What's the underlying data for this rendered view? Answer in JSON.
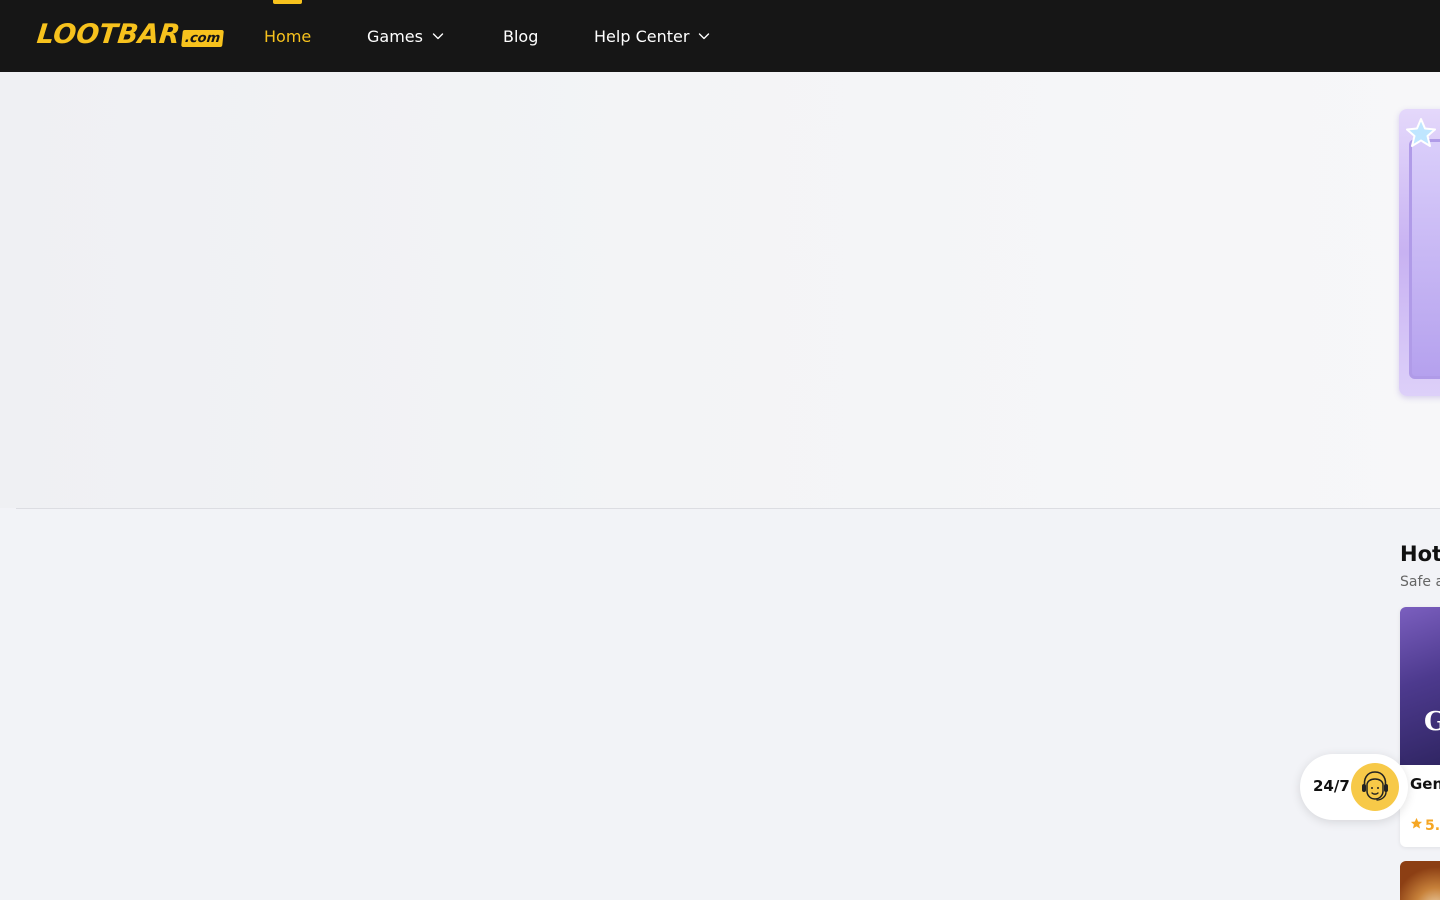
{
  "brand": {
    "logo_text": "LOOTBAR",
    "logo_suffix": ".com",
    "accent_color": "#f7c21d",
    "header_bg": "#161616"
  },
  "nav": {
    "items": [
      {
        "label": "Home",
        "active": true,
        "has_dropdown": false
      },
      {
        "label": "Games",
        "active": false,
        "has_dropdown": true
      },
      {
        "label": "Blog",
        "active": false,
        "has_dropdown": false
      },
      {
        "label": "Help Center",
        "active": false,
        "has_dropdown": true
      }
    ]
  },
  "hot_section": {
    "title": "Hot",
    "subtitle": "Safe a",
    "cards": [
      {
        "thumb_letter": "G",
        "name": "Gen",
        "rating": "5.",
        "icon": "star-icon"
      }
    ]
  },
  "support": {
    "label": "24/7",
    "icon": "headset-agent-icon"
  }
}
